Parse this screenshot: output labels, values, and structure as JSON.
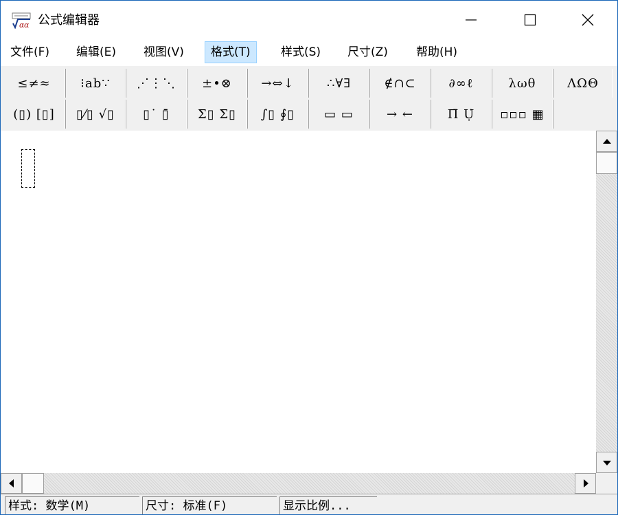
{
  "window": {
    "title": "公式编辑器",
    "accent": "#1a66b8"
  },
  "menu": {
    "items": [
      {
        "label": "文件(F)"
      },
      {
        "label": "编辑(E)"
      },
      {
        "label": "视图(V)"
      },
      {
        "label": "格式(T)"
      },
      {
        "label": "样式(S)"
      },
      {
        "label": "尺寸(Z)"
      },
      {
        "label": "帮助(H)"
      }
    ],
    "active_index": 3
  },
  "toolbar": {
    "row1": [
      {
        "symbols": "≤≠≈"
      },
      {
        "symbols": "⁝ab∵"
      },
      {
        "symbols": "⋰⋮⋱"
      },
      {
        "symbols": "±•⊗"
      },
      {
        "symbols": "→⇔↓"
      },
      {
        "symbols": "∴∀∃"
      },
      {
        "symbols": "∉∩⊂"
      },
      {
        "symbols": "∂∞ℓ"
      },
      {
        "symbols": "λωθ"
      },
      {
        "symbols": "ΛΩΘ"
      }
    ],
    "row2": [
      {
        "symbols": "(▯) [▯]"
      },
      {
        "symbols": "▯⁄▯ √▯"
      },
      {
        "symbols": "▯˙ ▯̄"
      },
      {
        "symbols": "Σ▯ Σ▯"
      },
      {
        "symbols": "∫▯ ∮▯"
      },
      {
        "symbols": "▭ ▭"
      },
      {
        "symbols": "→ ←"
      },
      {
        "symbols": "Π̄ Ụ̇"
      },
      {
        "symbols": "▫▫▫ ▦"
      },
      {
        "symbols": ""
      }
    ]
  },
  "statusbar": {
    "style": "样式: 数学(M)",
    "size": "尺寸: 标准(F)",
    "zoom": "显示比例..."
  }
}
